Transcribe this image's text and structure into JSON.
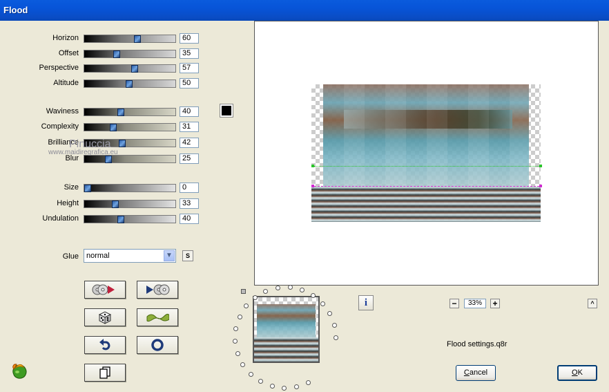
{
  "window": {
    "title": "Flood"
  },
  "sliders": [
    {
      "label": "Horizon",
      "value": "60",
      "level": 0.6
    },
    {
      "label": "Offset",
      "value": "35",
      "level": 0.35
    },
    {
      "label": "Perspective",
      "value": "57",
      "level": 0.57
    },
    {
      "label": "Altitude",
      "value": "50",
      "level": 0.5
    },
    {
      "label": "Waviness",
      "value": "40",
      "level": 0.4
    },
    {
      "label": "Complexity",
      "value": "31",
      "level": 0.31
    },
    {
      "label": "Brilliance",
      "value": "42",
      "level": 0.42
    },
    {
      "label": "Blur",
      "value": "25",
      "level": 0.25
    },
    {
      "label": "Size",
      "value": "0",
      "level": 0.0
    },
    {
      "label": "Height",
      "value": "33",
      "level": 0.33
    },
    {
      "label": "Undulation",
      "value": "40",
      "level": 0.4
    }
  ],
  "watermark": {
    "name": "Pinuccia",
    "url": "www.maidiregrafica.eu"
  },
  "glue": {
    "label": "Glue",
    "value": "normal"
  },
  "glue_s_button": "S",
  "color_swatch": "#000000",
  "preview": {
    "zoom": "33%"
  },
  "settings_file": "Flood settings.q8r",
  "buttons": {
    "cancel": "Cancel",
    "ok": "OK"
  }
}
